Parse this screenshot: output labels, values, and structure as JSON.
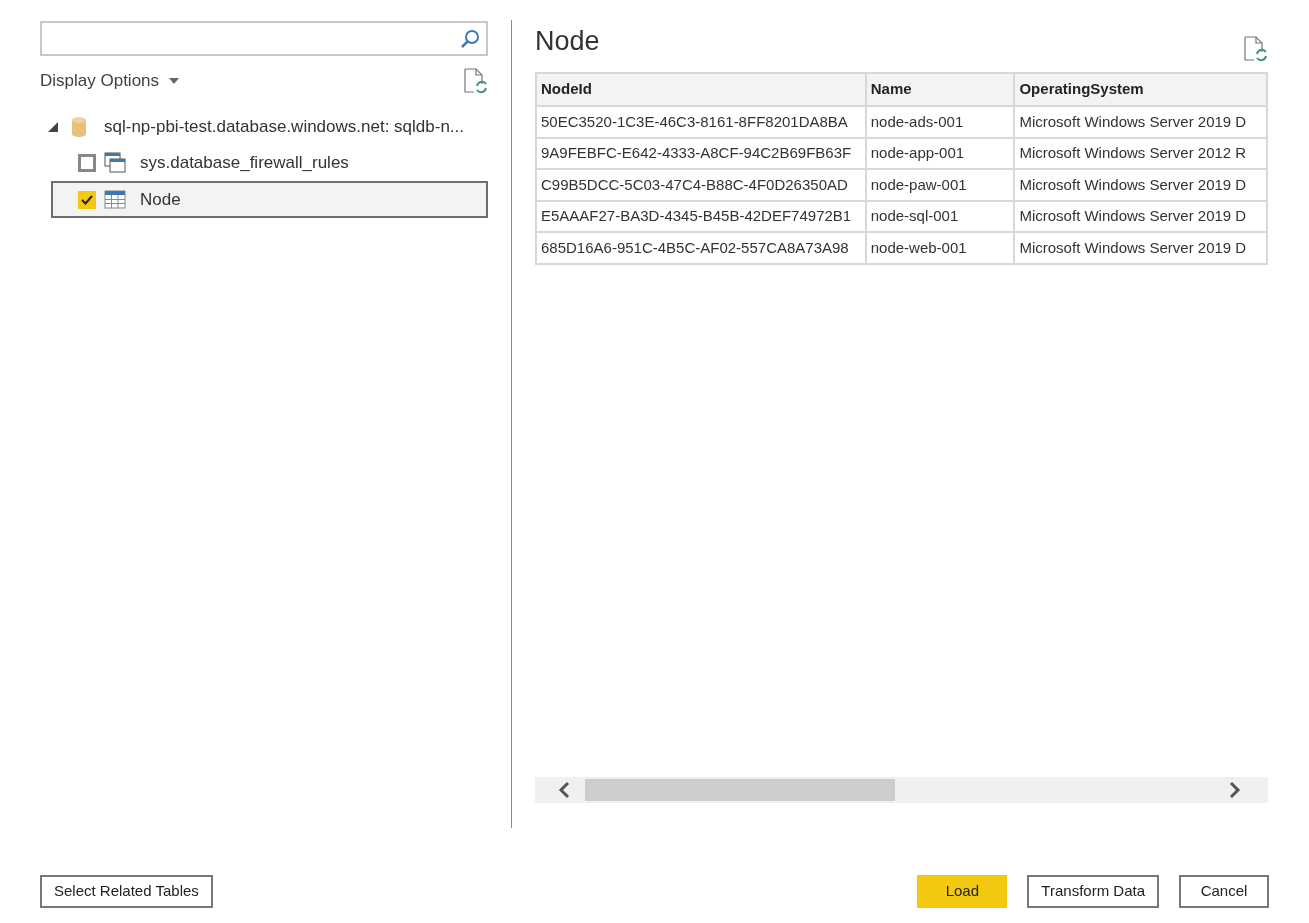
{
  "navigator": {
    "display_options": {
      "label": "Display Options"
    },
    "tree": [
      {
        "label": "sql-np-pbi-test.database.windows.net: sqldb-n...",
        "expanded": true,
        "children": [
          {
            "label": "sys.database_firewall_rules",
            "kind": "view",
            "checked": false,
            "selected": false
          },
          {
            "label": "Node",
            "kind": "table",
            "checked": true,
            "selected": true
          }
        ]
      }
    ]
  },
  "preview": {
    "title": "Node",
    "table": {
      "columns": [
        "NodeId",
        "Name",
        "OperatingSystem"
      ],
      "rows": [
        [
          "50EC3520-1C3E-46C3-8161-8FF8201DA8BA",
          "node-ads-001",
          "Microsoft Windows Server 2019 D"
        ],
        [
          "9A9FEBFC-E642-4333-A8CF-94C2B69FB63F",
          "node-app-001",
          "Microsoft Windows Server 2012 R"
        ],
        [
          "C99B5DCC-5C03-47C4-B88C-4F0D26350AD",
          "node-paw-001",
          "Microsoft Windows Server 2019 D"
        ],
        [
          "E5AAAF27-BA3D-4345-B45B-42DEF74972B1",
          "node-sql-001",
          "Microsoft Windows Server 2019 D"
        ],
        [
          "685D16A6-951C-4B5C-AF02-557CA8A73A98",
          "node-web-001",
          "Microsoft Windows Server 2019 D"
        ]
      ]
    }
  },
  "footer": {
    "left_buttons": [
      {
        "label": "Select Related Tables",
        "kind": "secondary"
      }
    ],
    "right_buttons": [
      {
        "label": "Load",
        "kind": "primary"
      },
      {
        "label": "Transform Data",
        "kind": "secondary"
      },
      {
        "label": "Cancel",
        "kind": "secondary"
      }
    ]
  }
}
